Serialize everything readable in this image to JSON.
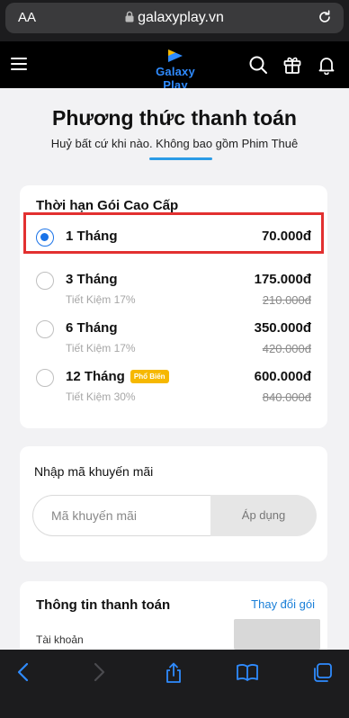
{
  "browser": {
    "text_size_label": "AA",
    "url": "galaxyplay.vn"
  },
  "header": {
    "logo_text": "Galaxy Play"
  },
  "page": {
    "title": "Phương thức thanh toán",
    "subtitle": "Huỷ bất cứ khi nào. Không bao gồm Phim Thuê"
  },
  "plans": {
    "title": "Thời hạn Gói Cao Cấp",
    "items": [
      {
        "name": "1 Tháng",
        "price": "70.000đ",
        "selected": true
      },
      {
        "name": "3 Tháng",
        "price": "175.000đ",
        "saving": "Tiết Kiệm 17%",
        "old_price": "210.000đ"
      },
      {
        "name": "6 Tháng",
        "price": "350.000đ",
        "saving": "Tiết Kiệm 17%",
        "old_price": "420.000đ"
      },
      {
        "name": "12 Tháng",
        "badge": "Phổ Biến",
        "price": "600.000đ",
        "saving": "Tiết Kiệm 30%",
        "old_price": "840.000đ"
      }
    ]
  },
  "promo": {
    "title": "Nhập mã khuyến mãi",
    "placeholder": "Mã khuyến mãi",
    "apply_label": "Áp dụng"
  },
  "payment": {
    "title": "Thông tin thanh toán",
    "change_label": "Thay đổi gói",
    "account_label": "Tài khoản"
  },
  "colors": {
    "accent": "#1a73e8",
    "link": "#1a7fd8",
    "badge": "#f6b800",
    "highlight_border": "#e23030",
    "underline": "#2b9be6"
  },
  "icons": {
    "browser": [
      "lock-icon",
      "reload-icon"
    ],
    "header": [
      "menu-icon",
      "search-icon",
      "gift-icon",
      "bell-icon"
    ],
    "toolbar": [
      "back-icon",
      "forward-icon",
      "share-icon",
      "bookmarks-icon",
      "tabs-icon"
    ]
  }
}
